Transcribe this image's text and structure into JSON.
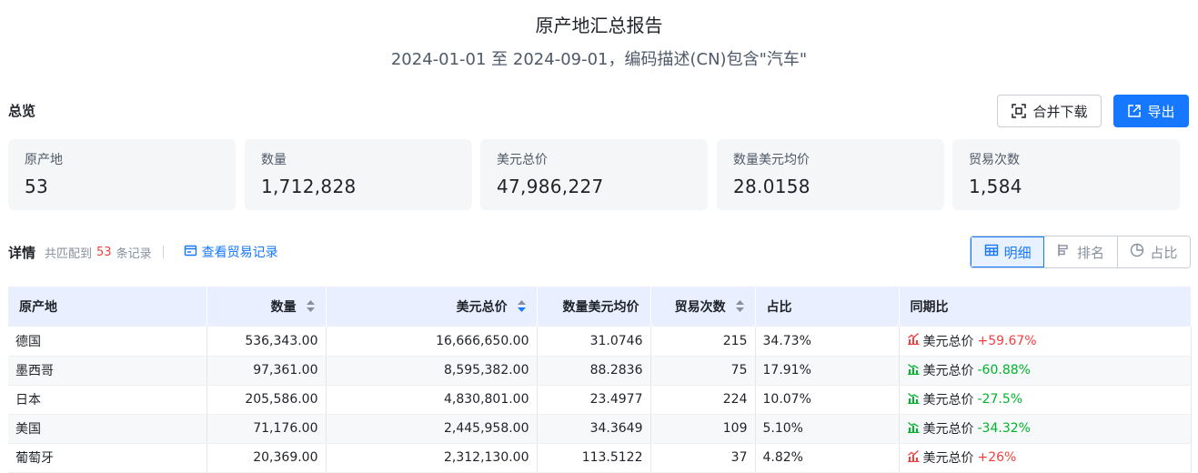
{
  "report": {
    "title": "原产地汇总报告",
    "subtitle": "2024-01-01 至 2024-09-01，编码描述(CN)包含\"汽车\""
  },
  "overview": {
    "heading": "总览",
    "merge_download_label": "合并下载",
    "export_label": "导出",
    "stats": [
      {
        "label": "原产地",
        "value": "53"
      },
      {
        "label": "数量",
        "value": "1,712,828"
      },
      {
        "label": "美元总价",
        "value": "47,986,227"
      },
      {
        "label": "数量美元均价",
        "value": "28.0158"
      },
      {
        "label": "贸易次数",
        "value": "1,584"
      }
    ]
  },
  "details": {
    "heading": "详情",
    "match_prefix": "共匹配到",
    "match_count": "53",
    "match_suffix": "条记录",
    "view_records_link": "查看贸易记录",
    "view_modes": [
      "明细",
      "排名",
      "占比"
    ],
    "active_view": "明细"
  },
  "table": {
    "columns": [
      "原产地",
      "数量",
      "美元总价",
      "数量美元均价",
      "贸易次数",
      "占比",
      "同期比"
    ],
    "rows": [
      {
        "origin": "德国",
        "quantity": "536,343.00",
        "usd_total": "16,666,650.00",
        "avg_price": "31.0746",
        "trades": "215",
        "share": "34.73%",
        "yoy_label": "美元总价",
        "yoy_value": "+59.67%",
        "yoy_trend": "up"
      },
      {
        "origin": "墨西哥",
        "quantity": "97,361.00",
        "usd_total": "8,595,382.00",
        "avg_price": "88.2836",
        "trades": "75",
        "share": "17.91%",
        "yoy_label": "美元总价",
        "yoy_value": "-60.88%",
        "yoy_trend": "down"
      },
      {
        "origin": "日本",
        "quantity": "205,586.00",
        "usd_total": "4,830,801.00",
        "avg_price": "23.4977",
        "trades": "224",
        "share": "10.07%",
        "yoy_label": "美元总价",
        "yoy_value": "-27.5%",
        "yoy_trend": "down"
      },
      {
        "origin": "美国",
        "quantity": "71,176.00",
        "usd_total": "2,445,958.00",
        "avg_price": "34.3649",
        "trades": "109",
        "share": "5.10%",
        "yoy_label": "美元总价",
        "yoy_value": "-34.32%",
        "yoy_trend": "down"
      },
      {
        "origin": "葡萄牙",
        "quantity": "20,369.00",
        "usd_total": "2,312,130.00",
        "avg_price": "113.5122",
        "trades": "37",
        "share": "4.82%",
        "yoy_label": "美元总价",
        "yoy_value": "+26%",
        "yoy_trend": "up"
      }
    ]
  },
  "colors": {
    "accent": "#1677ff",
    "up": "#f53f3f",
    "down": "#00b42a",
    "header_bg": "#e9efff"
  }
}
